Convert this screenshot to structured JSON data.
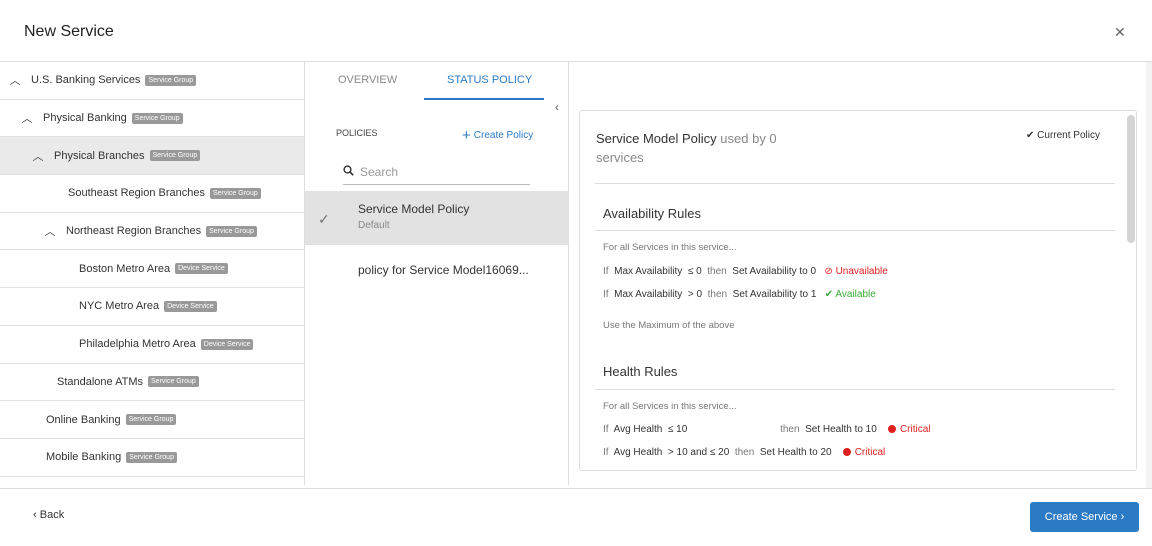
{
  "modal": {
    "title": "New Service",
    "close_icon": "✕"
  },
  "tree": [
    {
      "label": "U.S. Banking Services",
      "badge": "Service Group",
      "chevron": "^",
      "level": 0
    },
    {
      "label": "Physical Banking",
      "badge": "Service Group",
      "chevron": "^",
      "level": 1
    },
    {
      "label": "Physical Branches",
      "badge": "Service Group",
      "chevron": "^",
      "level": 2,
      "selected": true
    },
    {
      "label": "Southeast Region Branches",
      "badge": "Service Group",
      "level": 3
    },
    {
      "label": "Northeast Region Branches",
      "badge": "Service Group",
      "chevron": "^",
      "level": 2
    },
    {
      "label": "Boston Metro Area",
      "badge": "Device Service",
      "level": 4
    },
    {
      "label": "NYC Metro Area",
      "badge": "Device Service",
      "level": 4
    },
    {
      "label": "Philadelphia Metro Area",
      "badge": "Device Service",
      "level": 4
    },
    {
      "label": "Standalone ATMs",
      "badge": "Service Group",
      "level": 2
    },
    {
      "label": "Online Banking",
      "badge": "Service Group",
      "level": 1
    },
    {
      "label": "Mobile Banking",
      "badge": "Service Group",
      "level": 1
    }
  ],
  "tabs": {
    "overview": "OVERVIEW",
    "status_policy": "STATUS POLICY",
    "active": "status_policy"
  },
  "policies": {
    "heading": "POLICIES",
    "create_label": "Create Policy",
    "search_placeholder": "Search",
    "items": [
      {
        "name": "Service Model Policy",
        "sub": "Default",
        "selected": true
      },
      {
        "name": "policy for Service Model16069...",
        "sub": ""
      }
    ]
  },
  "detail": {
    "title": "Service Model Policy",
    "used_by_text": "used by 0",
    "services_text": "services",
    "current_policy": "Current Policy",
    "availability": {
      "title": "Availability Rules",
      "intro": "For all Services in this service...",
      "rules": [
        {
          "if": "If",
          "metric": "Max Availability",
          "cond": "≤ 0",
          "then": "then",
          "set": "Set Availability to 0",
          "status": "Unavailable",
          "status_icon": "⊘",
          "color": "#e02020"
        },
        {
          "if": "If",
          "metric": "Max Availability",
          "cond": "> 0",
          "then": "then",
          "set": "Set Availability to 1",
          "status": "Available",
          "status_icon": "✔",
          "color": "#3aaa35"
        }
      ],
      "footer": "Use the Maximum of the above"
    },
    "health": {
      "title": "Health Rules",
      "intro": "For all Services in this service...",
      "rules": [
        {
          "if": "If",
          "metric": "Avg Health",
          "cond": "≤ 10",
          "then": "then",
          "set": "Set Health to 10",
          "status": "Critical",
          "color": "#e02020"
        },
        {
          "if": "If",
          "metric": "Avg Health",
          "cond": "> 10 and ≤ 20",
          "then": "then",
          "set": "Set Health to 20",
          "status": "Critical",
          "color": "#e02020"
        }
      ]
    }
  },
  "footer": {
    "back_label": "Back",
    "create_label": "Create Service"
  },
  "colors": {
    "accent": "#2a7ac6",
    "critical": "#e02020",
    "available": "#3aaa35"
  }
}
